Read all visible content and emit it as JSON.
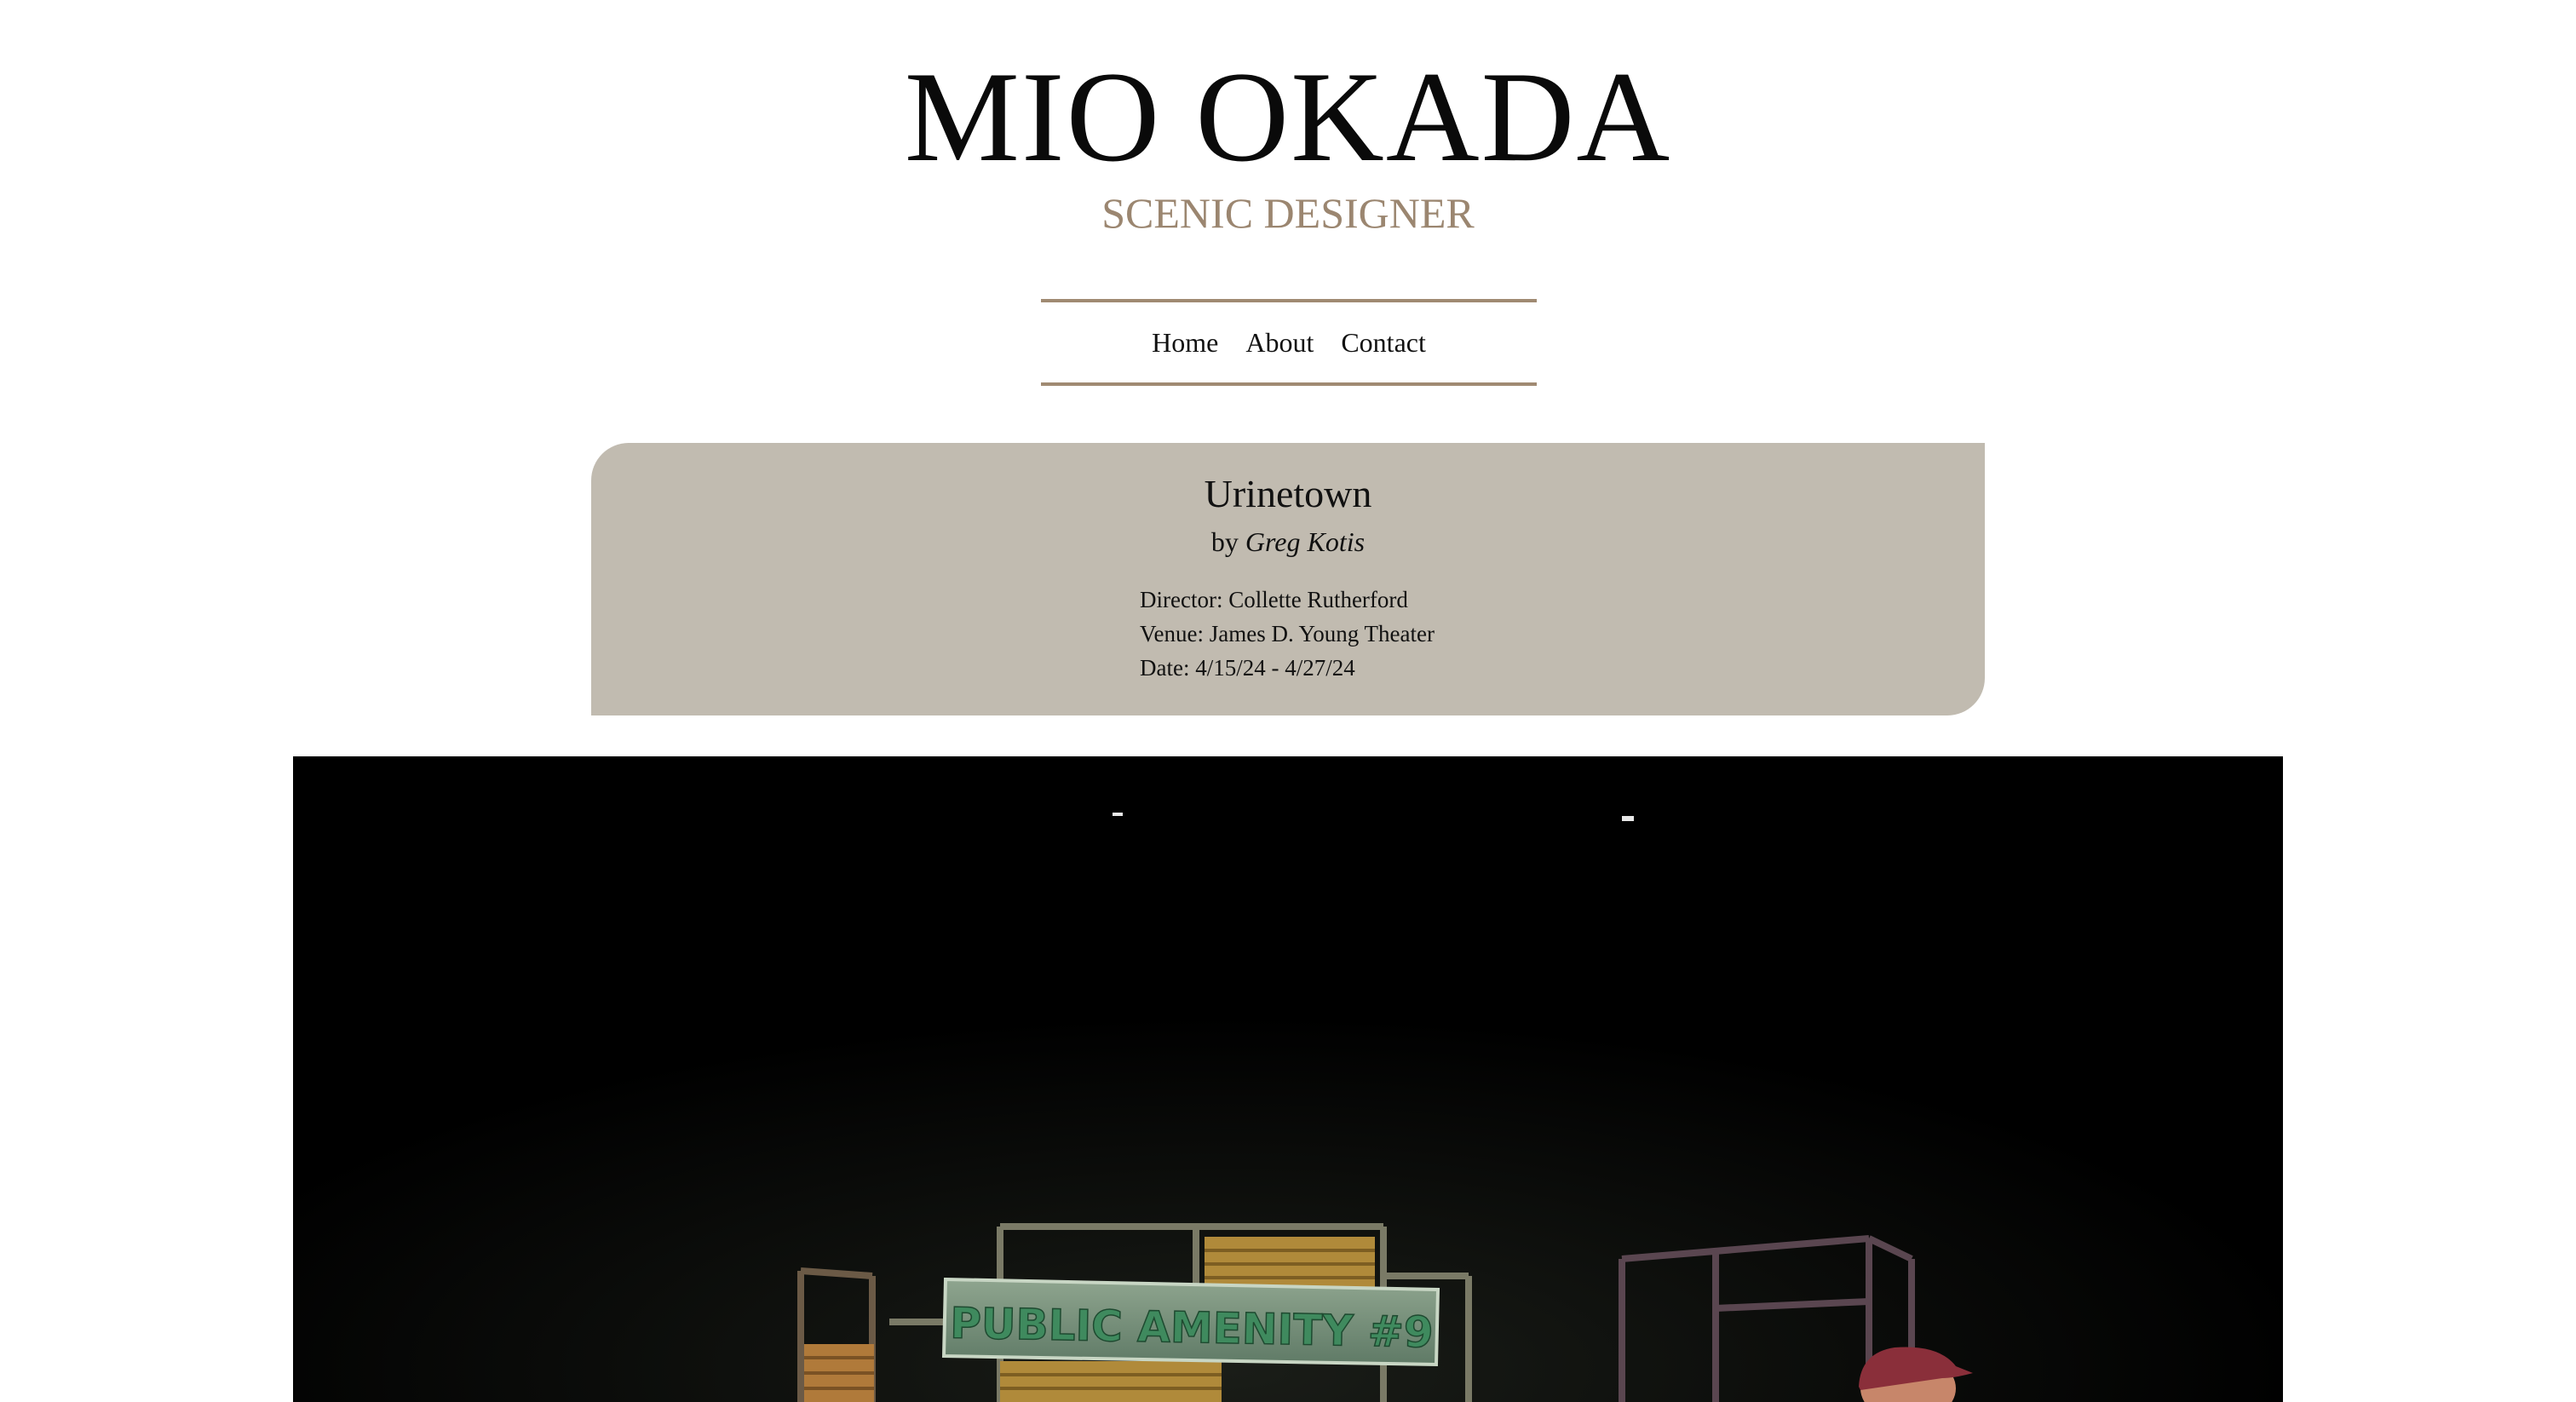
{
  "header": {
    "title": "MIO OKADA",
    "subtitle": "SCENIC DESIGNER"
  },
  "nav": {
    "items": [
      {
        "label": "Home"
      },
      {
        "label": "About"
      },
      {
        "label": "Contact"
      }
    ]
  },
  "production": {
    "title": "Urinetown",
    "by_prefix": "by",
    "author": "Greg Kotis",
    "director": "Director: Collette Rutherford",
    "venue": "Venue: James D. Young Theater",
    "date": "Date: 4/15/24 - 4/27/24"
  },
  "photo": {
    "sign_text": "PUBLIC AMENITY #9"
  },
  "colors": {
    "accent": "#a08a72",
    "subtitle": "#9b8670",
    "card_background": "#c1bbb0",
    "photo_background": "#000000",
    "sign_green": "#3f8a5e"
  }
}
